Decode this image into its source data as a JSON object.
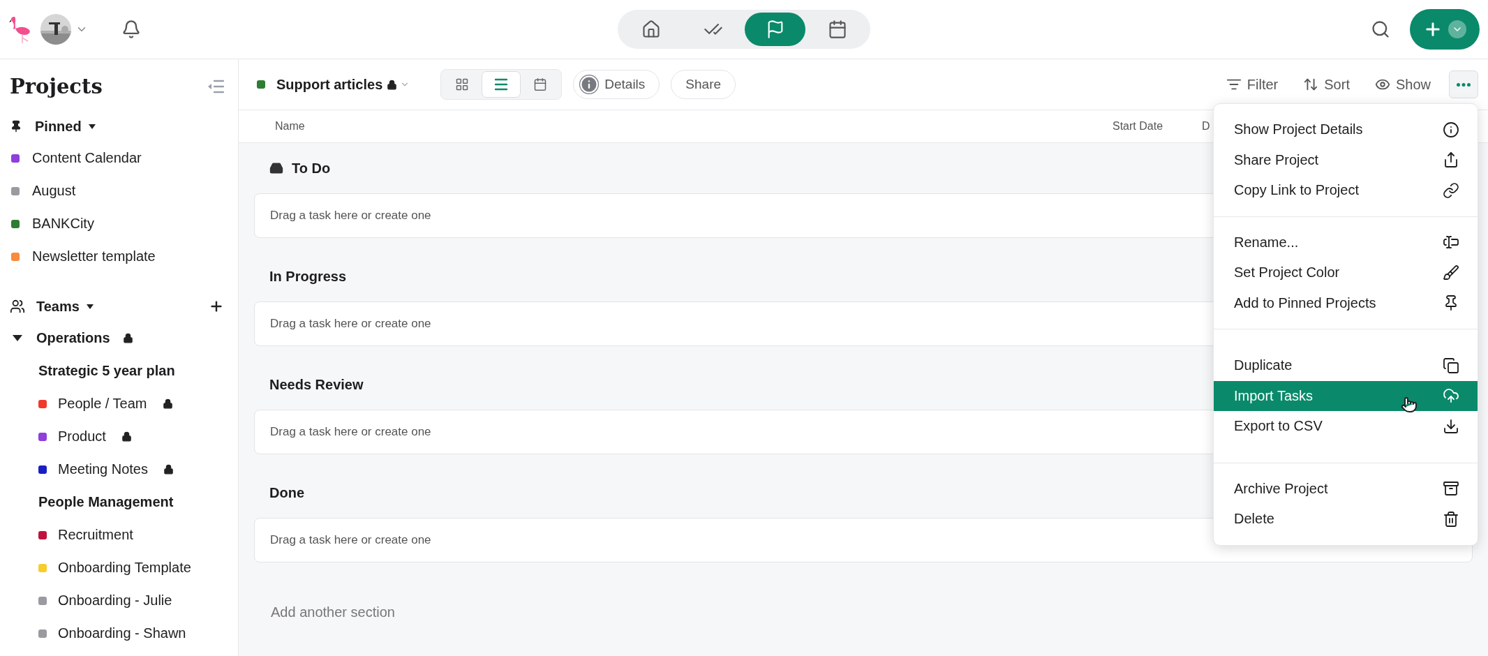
{
  "top_nav": {
    "tabs": [
      {
        "selected": false
      },
      {
        "selected": false
      },
      {
        "selected": true
      },
      {
        "selected": false
      }
    ]
  },
  "sidebar": {
    "title": "Projects",
    "pinned": {
      "label": "Pinned",
      "items": [
        {
          "name": "Content Calendar",
          "color": "#8e3fdc"
        },
        {
          "name": "August",
          "color": "#9a9ba0"
        },
        {
          "name": "BANKCity",
          "color": "#2f7d32"
        },
        {
          "name": "Newsletter template",
          "color": "#f68c3c"
        }
      ]
    },
    "teams": {
      "label": "Teams",
      "groups": [
        {
          "name": "Operations",
          "locked": true,
          "expanded": true,
          "children": [
            {
              "name": "Strategic 5 year plan",
              "children": [
                {
                  "name": "People / Team",
                  "color": "#f0392b",
                  "locked": true
                },
                {
                  "name": "Product",
                  "color": "#8e3fdc",
                  "locked": true
                },
                {
                  "name": "Meeting Notes",
                  "color": "#1a1fc4",
                  "locked": true
                }
              ]
            },
            {
              "name": "People Management",
              "children": [
                {
                  "name": "Recruitment",
                  "color": "#c0123f",
                  "locked": false
                },
                {
                  "name": "Onboarding Template",
                  "color": "#f7cd2e",
                  "locked": false
                },
                {
                  "name": "Onboarding - Julie",
                  "color": "#9a9ba0",
                  "locked": false
                },
                {
                  "name": "Onboarding - Shawn",
                  "color": "#9a9ba0",
                  "locked": false
                }
              ]
            }
          ]
        }
      ]
    }
  },
  "project": {
    "name": "Support articles",
    "color": "#2f7d32",
    "locked": true
  },
  "views": [
    {
      "selected": false
    },
    {
      "selected": true
    },
    {
      "selected": false
    }
  ],
  "details_button": "Details",
  "share_button": "Share",
  "filter": "Filter",
  "sort": "Sort",
  "show": "Show",
  "columns": [
    "Name",
    "Start Date",
    "D"
  ],
  "sections": [
    {
      "title": "To Do",
      "kind": "inbox",
      "placeholder": "Drag a task here or create one"
    },
    {
      "title": "In Progress",
      "kind": "plain",
      "placeholder": "Drag a task here or create one"
    },
    {
      "title": "Needs Review",
      "kind": "plain",
      "placeholder": "Drag a task here or create one"
    },
    {
      "title": "Done",
      "kind": "plain",
      "placeholder": "Drag a task here or create one"
    }
  ],
  "add_section": "Add another section",
  "menu": {
    "groups": [
      [
        {
          "label": "Show Project Details",
          "selected": false
        },
        {
          "label": "Share Project",
          "selected": false
        },
        {
          "label": "Copy Link to Project",
          "selected": false
        }
      ],
      [
        {
          "label": "Rename...",
          "selected": false
        },
        {
          "label": "Set Project Color",
          "selected": false
        },
        {
          "label": "Add to Pinned Projects",
          "selected": false
        }
      ],
      [
        {
          "label": "Duplicate",
          "selected": false
        },
        {
          "label": "Import Tasks",
          "selected": true
        },
        {
          "label": "Export to CSV",
          "selected": false
        }
      ],
      [
        {
          "label": "Archive Project",
          "selected": false
        },
        {
          "label": "Delete",
          "selected": false
        }
      ]
    ]
  }
}
